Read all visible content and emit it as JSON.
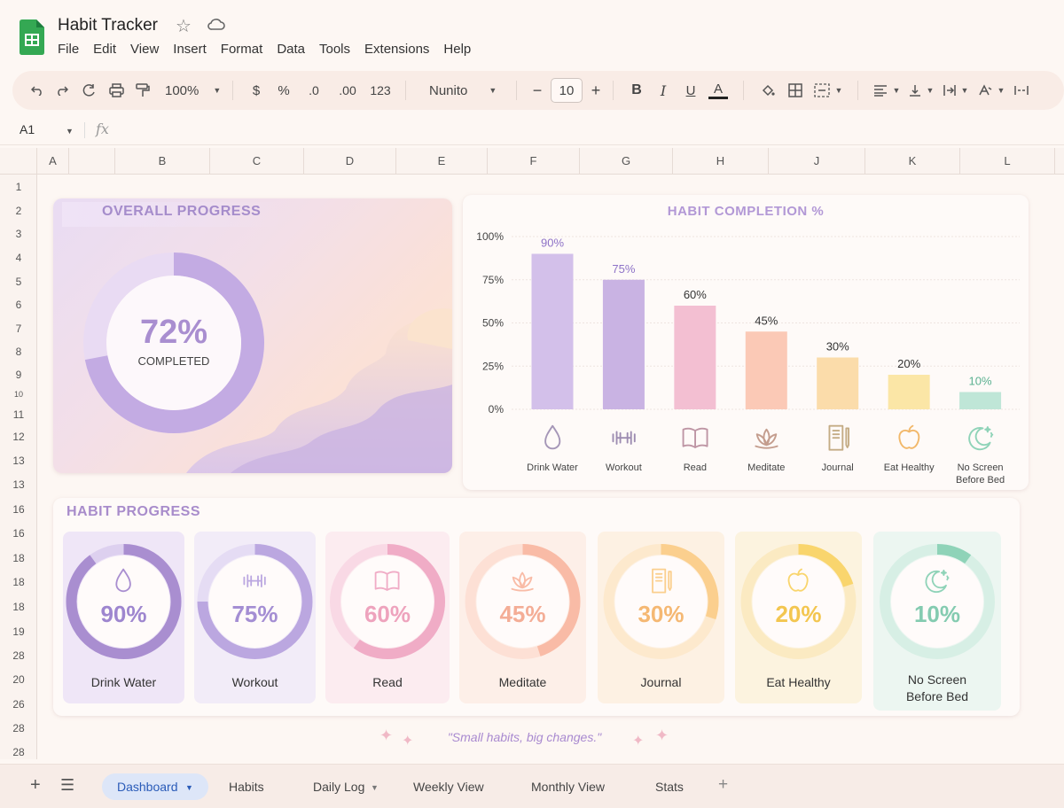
{
  "app": {
    "title": "Habit Tracker"
  },
  "menu": [
    "File",
    "Edit",
    "View",
    "Insert",
    "Format",
    "Data",
    "Tools",
    "Extensions",
    "Help"
  ],
  "toolbar": {
    "zoom": "100%",
    "currency": "$",
    "percent": "%",
    "dec_decrease": ".0",
    "dec_increase": ".00",
    "number_format": "123",
    "font": "Nunito",
    "font_size": "10",
    "minus": "−",
    "plus": "+",
    "bold": "B",
    "italic": "I",
    "underline": "U",
    "text_color": "A"
  },
  "formula": {
    "cell": "A1",
    "fx": "fx"
  },
  "columns": [
    "A",
    "B",
    "C",
    "D",
    "E",
    "F",
    "G",
    "H",
    "J",
    "K",
    "L"
  ],
  "rows": [
    "1",
    "2",
    "3",
    "4",
    "5",
    "6",
    "7",
    "8",
    "9",
    "10",
    "11",
    "12",
    "13",
    "13",
    "16",
    "16",
    "18",
    "18",
    "18",
    "19",
    "28",
    "20",
    "26",
    "28",
    "28"
  ],
  "overall": {
    "title": "OVERALL PROGRESS",
    "percent": "72%",
    "subtitle": "COMPLETED",
    "value": 0.72
  },
  "chart_data": {
    "type": "bar",
    "title": "HABIT COMPLETION %",
    "categories": [
      "Drink Water",
      "Workout",
      "Read",
      "Meditate",
      "Journal",
      "Eat Healthy",
      "No Screen Before Bed"
    ],
    "values": [
      90,
      75,
      60,
      45,
      30,
      20,
      10
    ],
    "data_labels": [
      "90%",
      "75%",
      "60%",
      "45%",
      "30%",
      "20%",
      "10%"
    ],
    "ylim": [
      0,
      100
    ],
    "yticks": [
      "0%",
      "25%",
      "50%",
      "75%",
      "100%"
    ],
    "colors": [
      "#d3c0ea",
      "#c9b3e3",
      "#f3bfd2",
      "#fbc9b6",
      "#fbdcaa",
      "#fbe6a6",
      "#bfe6d7"
    ],
    "label_colors": [
      "#8e72c7",
      "#8e72c7",
      "#333333",
      "#333333",
      "#333333",
      "#333333",
      "#5bb191"
    ],
    "icons": [
      "droplet-icon",
      "dumbbell-icon",
      "book-icon",
      "lotus-icon",
      "journal-icon",
      "apple-icon",
      "moon-icon"
    ],
    "grid": true
  },
  "habit_progress": {
    "title": "HABIT PROGRESS",
    "items": [
      {
        "label": "Drink Water",
        "percent": "90%",
        "value": 0.9,
        "ring": "#a98ed0",
        "track": "#ddd0ef",
        "text": "#9e86cf",
        "bg": "#efe6f7",
        "icon": "droplet-icon"
      },
      {
        "label": "Workout",
        "percent": "75%",
        "value": 0.75,
        "ring": "#bba7e0",
        "track": "#e5dcf4",
        "text": "#a48ed3",
        "bg": "#f2ecf8",
        "icon": "dumbbell-icon"
      },
      {
        "label": "Read",
        "percent": "60%",
        "value": 0.6,
        "ring": "#f0acc6",
        "track": "#f9d9e5",
        "text": "#eea3bd",
        "bg": "#fcecf0",
        "icon": "book-icon"
      },
      {
        "label": "Meditate",
        "percent": "45%",
        "value": 0.45,
        "ring": "#f9bba6",
        "track": "#fde0d5",
        "text": "#f4ad96",
        "bg": "#fdefe8",
        "icon": "lotus-icon"
      },
      {
        "label": "Journal",
        "percent": "30%",
        "value": 0.3,
        "ring": "#fbcf8e",
        "track": "#fde9cd",
        "text": "#f5b873",
        "bg": "#fdf1e3",
        "icon": "journal-icon"
      },
      {
        "label": "Eat Healthy",
        "percent": "20%",
        "value": 0.2,
        "ring": "#f9d56d",
        "track": "#fbeac2",
        "text": "#f3c650",
        "bg": "#fcf3df",
        "icon": "apple-icon"
      },
      {
        "label": "No Screen\nBefore Bed",
        "label_line1": "No Screen",
        "label_line2": "Before Bed",
        "percent": "10%",
        "value": 0.1,
        "ring": "#8fd3b8",
        "track": "#d7efe5",
        "text": "#84cbb0",
        "bg": "#ecf6f1",
        "icon": "moon-icon"
      }
    ]
  },
  "quote": "\"Small habits, big changes.\"",
  "tabs": [
    {
      "label": "Dashboard",
      "active": true
    },
    {
      "label": "Habits"
    },
    {
      "label": "Daily Log"
    },
    {
      "label": "Weekly View"
    },
    {
      "label": "Monthly View"
    },
    {
      "label": "Stats"
    }
  ]
}
